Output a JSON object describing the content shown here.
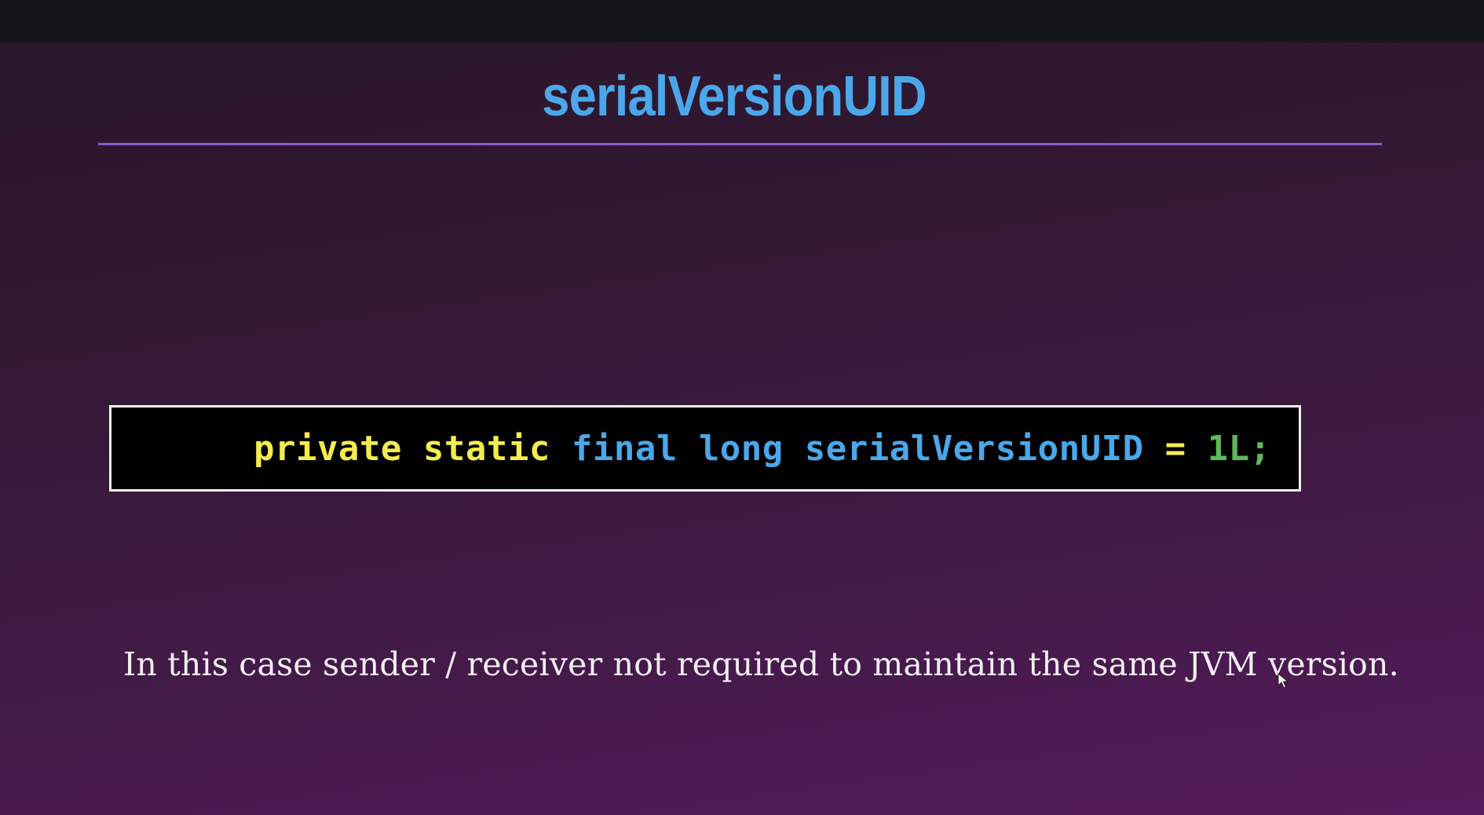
{
  "slide": {
    "title": "serialVersionUID",
    "note": "In this case sender / receiver not required to maintain the same JVM version."
  },
  "code": {
    "tokens": [
      {
        "text": "private",
        "role": "keyword-modifier"
      },
      {
        "text": " ",
        "role": "space"
      },
      {
        "text": "static",
        "role": "keyword-modifier"
      },
      {
        "text": " ",
        "role": "space"
      },
      {
        "text": "final",
        "role": "keyword-type"
      },
      {
        "text": " ",
        "role": "space"
      },
      {
        "text": "long",
        "role": "keyword-type"
      },
      {
        "text": " ",
        "role": "space"
      },
      {
        "text": "serialVersionUID",
        "role": "identifier"
      },
      {
        "text": " ",
        "role": "space"
      },
      {
        "text": "=",
        "role": "operator"
      },
      {
        "text": " ",
        "role": "space"
      },
      {
        "text": "1L;",
        "role": "literal"
      }
    ]
  },
  "colors": {
    "title": "#4aa8ea",
    "rule": "#8a5bc9",
    "note": "#f4f0f4",
    "modifier": "#f3ec4e",
    "type": "#4aa8ea",
    "identifier": "#4aa8ea",
    "operator": "#f3ec4e",
    "literal": "#5fb85a",
    "code_bg": "#000000",
    "code_border": "#f2f2f2"
  },
  "icons": {
    "cursor": "mouse-pointer-icon"
  }
}
